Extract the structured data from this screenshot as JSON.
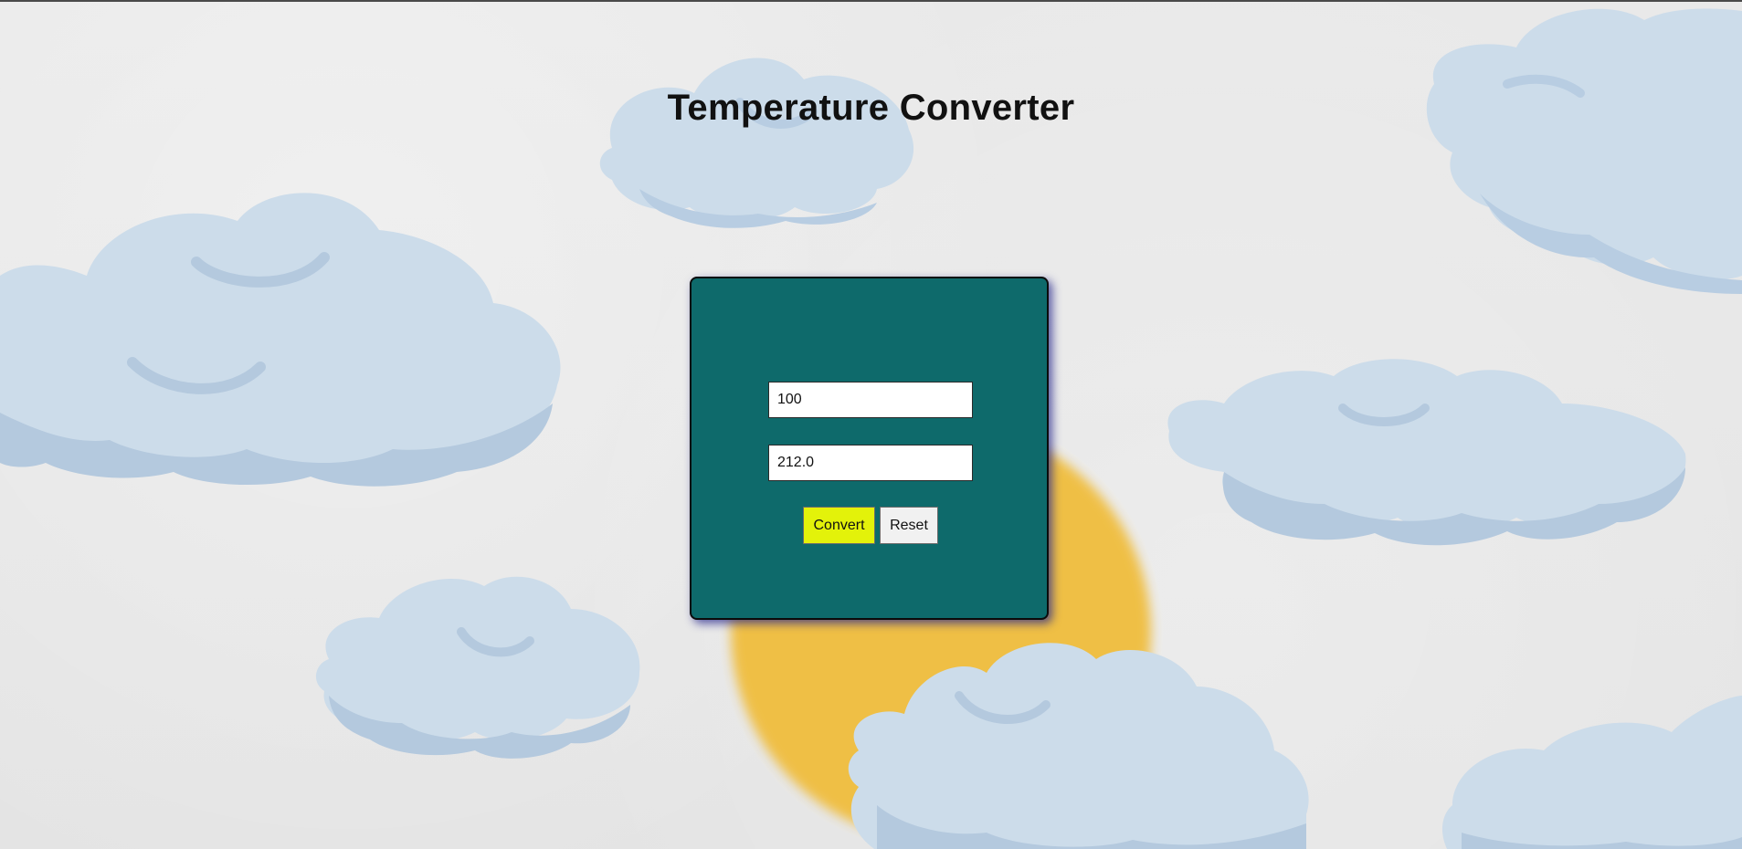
{
  "page": {
    "title": "Temperature Converter"
  },
  "converter": {
    "input_value": "100",
    "output_value": "212.0",
    "convert_label": "Convert",
    "reset_label": "Reset"
  },
  "colors": {
    "card_background": "#0e6a6b",
    "convert_button": "#e3f20a",
    "reset_button": "#f1f1f1",
    "cloud": "#ccdcea",
    "sun": "#f0bd3c"
  }
}
